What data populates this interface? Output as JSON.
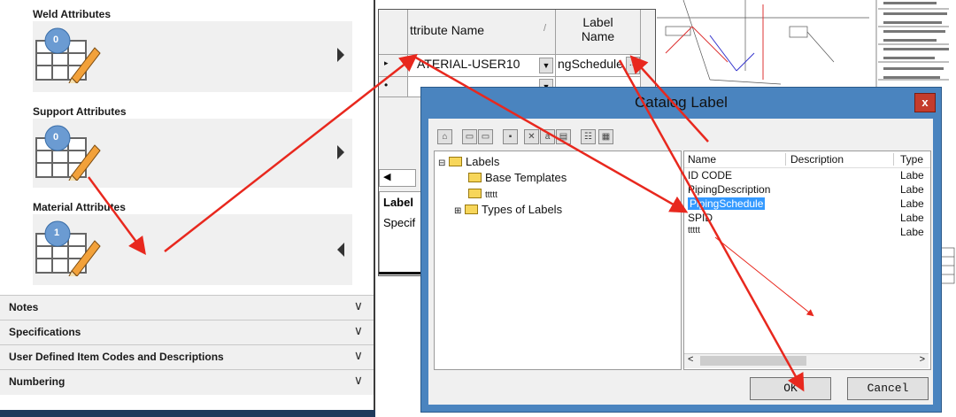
{
  "left_panel": {
    "sections": [
      {
        "title": "Weld Attributes",
        "count": "0",
        "arrow": "right"
      },
      {
        "title": "Support Attributes",
        "count": "0",
        "arrow": "right"
      },
      {
        "title": "Material Attributes",
        "count": "1",
        "arrow": "left"
      }
    ],
    "collapsibles": [
      {
        "label": "Notes"
      },
      {
        "label": "Specifications"
      },
      {
        "label": "User Defined Item Codes and Descriptions"
      },
      {
        "label": "Numbering"
      }
    ],
    "chevron": "∨"
  },
  "grid": {
    "col_attr": "ttribute Name",
    "col_label_l1": "Label",
    "col_label_l2": "Name",
    "row1_attr": "ATERIAL-USER10",
    "row1_label": "ngSchedule",
    "ellipsis": "...",
    "lower_label": "Label",
    "lower_spec": "Specif"
  },
  "dialog": {
    "title": "Catalog Label",
    "close": "x",
    "tree": {
      "root": "Labels",
      "children": [
        "Base Templates",
        "ttttt",
        "Types of Labels"
      ]
    },
    "list": {
      "columns": [
        "Name",
        "Description",
        "Type"
      ],
      "rows": [
        {
          "name": "ID CODE",
          "type": "Labe"
        },
        {
          "name": "PipingDescription",
          "type": "Labe"
        },
        {
          "name": "PipingSchedule",
          "type": "Labe",
          "selected": true
        },
        {
          "name": "SPID",
          "type": "Labe"
        },
        {
          "name": "ttttt",
          "type": "Labe"
        }
      ]
    },
    "ok_label": "OK",
    "cancel_label": "Cancel"
  },
  "colors": {
    "accent_blue": "#4a84bf",
    "selection": "#3399ff",
    "annotation_red": "#e8281e"
  }
}
